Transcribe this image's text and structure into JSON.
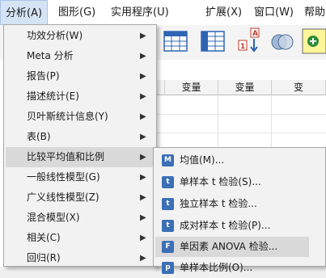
{
  "menubar": {
    "items": [
      {
        "label": "分析(A)"
      },
      {
        "label": "图形(G)"
      },
      {
        "label": "实用程序(U)"
      },
      {
        "label": "扩展(X)"
      },
      {
        "label": "窗口(W)"
      },
      {
        "label": "帮助(H)"
      }
    ]
  },
  "grid": {
    "columns": [
      "变量",
      "变量",
      "变"
    ]
  },
  "analyze_menu": {
    "items": [
      {
        "label": "功效分析(W)",
        "submenu": true
      },
      {
        "label": "Meta 分析",
        "submenu": true
      },
      {
        "label": "报告(P)",
        "submenu": true
      },
      {
        "label": "描述统计(E)",
        "submenu": true
      },
      {
        "label": "贝叶斯统计信息(Y)",
        "submenu": true
      },
      {
        "label": "表(B)",
        "submenu": true
      },
      {
        "label": "比较平均值和比例",
        "submenu": true,
        "highlighted": true
      },
      {
        "label": "一般线性模型(G)",
        "submenu": true
      },
      {
        "label": "广义线性模型(Z)",
        "submenu": true
      },
      {
        "label": "混合模型(X)",
        "submenu": true
      },
      {
        "label": "相关(C)",
        "submenu": true
      },
      {
        "label": "回归(R)",
        "submenu": true
      }
    ]
  },
  "compare_means_submenu": {
    "items": [
      {
        "label": "均值(M)...",
        "icon": "M"
      },
      {
        "label": "单样本 t 检验(S)...",
        "icon": "t"
      },
      {
        "label": "独立样本 t 检验...",
        "icon": "t"
      },
      {
        "label": "成对样本 t 检验(P)...",
        "icon": "t"
      },
      {
        "label": "单因素 ANOVA 检验...",
        "icon": "F",
        "highlighted": true
      },
      {
        "label": "单样本比例(O)...",
        "icon": "p"
      }
    ]
  },
  "colors": {
    "accent": "#3b6fb6",
    "highlight": "#d9d9d9",
    "menubar_active": "#d5e4f4"
  }
}
